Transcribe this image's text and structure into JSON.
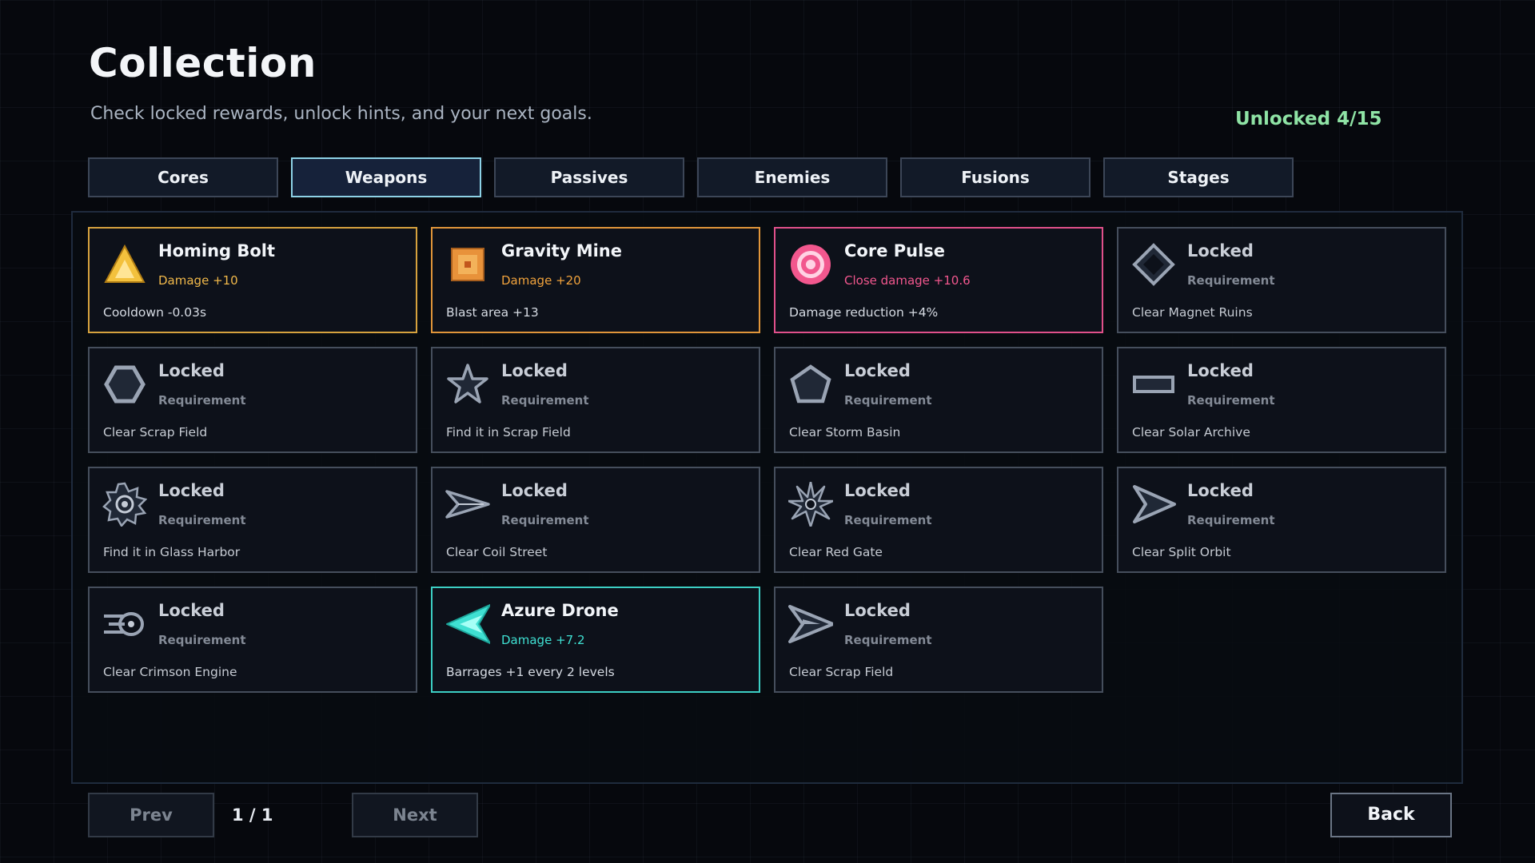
{
  "header": {
    "title": "Collection",
    "subtitle": "Check locked rewards, unlock hints, and your next goals.",
    "unlocked": "Unlocked 4/15"
  },
  "tabs": [
    {
      "label": "Cores",
      "active": false
    },
    {
      "label": "Weapons",
      "active": true
    },
    {
      "label": "Passives",
      "active": false
    },
    {
      "label": "Enemies",
      "active": false
    },
    {
      "label": "Fusions",
      "active": false
    },
    {
      "label": "Stages",
      "active": false
    }
  ],
  "cards": [
    {
      "name": "Homing Bolt",
      "stat": "Damage +10",
      "desc": "Cooldown -0.03s",
      "locked": false,
      "icon": "triangle-icon",
      "accent": "#f0b84a",
      "border": "#d6a23e"
    },
    {
      "name": "Gravity Mine",
      "stat": "Damage +20",
      "desc": "Blast area +13",
      "locked": false,
      "icon": "square-mine-icon",
      "accent": "#f0a23c",
      "border": "#e0953a"
    },
    {
      "name": "Core Pulse",
      "stat": "Close damage +10.6",
      "desc": "Damage reduction +4%",
      "locked": false,
      "icon": "ring-icon",
      "accent": "#f2578e",
      "border": "#e0508a"
    },
    {
      "name": "Locked",
      "stat": "Requirement",
      "desc": "Clear Magnet Ruins",
      "locked": true,
      "icon": "diamond-icon"
    },
    {
      "name": "Locked",
      "stat": "Requirement",
      "desc": "Clear Scrap Field",
      "locked": true,
      "icon": "hexagon-icon"
    },
    {
      "name": "Locked",
      "stat": "Requirement",
      "desc": "Find it in Scrap Field",
      "locked": true,
      "icon": "star-icon"
    },
    {
      "name": "Locked",
      "stat": "Requirement",
      "desc": "Clear Storm Basin",
      "locked": true,
      "icon": "pentagon-icon"
    },
    {
      "name": "Locked",
      "stat": "Requirement",
      "desc": "Clear Solar Archive",
      "locked": true,
      "icon": "bar-icon"
    },
    {
      "name": "Locked",
      "stat": "Requirement",
      "desc": "Find it in Glass Harbor",
      "locked": true,
      "icon": "gear-icon"
    },
    {
      "name": "Locked",
      "stat": "Requirement",
      "desc": "Clear Coil Street",
      "locked": true,
      "icon": "dart-icon"
    },
    {
      "name": "Locked",
      "stat": "Requirement",
      "desc": "Clear Red Gate",
      "locked": true,
      "icon": "spiked-star-icon"
    },
    {
      "name": "Locked",
      "stat": "Requirement",
      "desc": "Clear Split Orbit",
      "locked": true,
      "icon": "arrowhead-icon"
    },
    {
      "name": "Locked",
      "stat": "Requirement",
      "desc": "Clear Crimson Engine",
      "locked": true,
      "icon": "engine-icon"
    },
    {
      "name": "Azure Drone",
      "stat": "Damage +7.2",
      "desc": "Barrages +1 every 2 levels",
      "locked": false,
      "icon": "drone-icon",
      "accent": "#3fe0d2",
      "border": "#3ccfc4"
    },
    {
      "name": "Locked",
      "stat": "Requirement",
      "desc": "Clear Scrap Field",
      "locked": true,
      "icon": "ship-icon"
    }
  ],
  "pagination": {
    "prev": "Prev",
    "page": "1 / 1",
    "next": "Next"
  },
  "back": "Back"
}
